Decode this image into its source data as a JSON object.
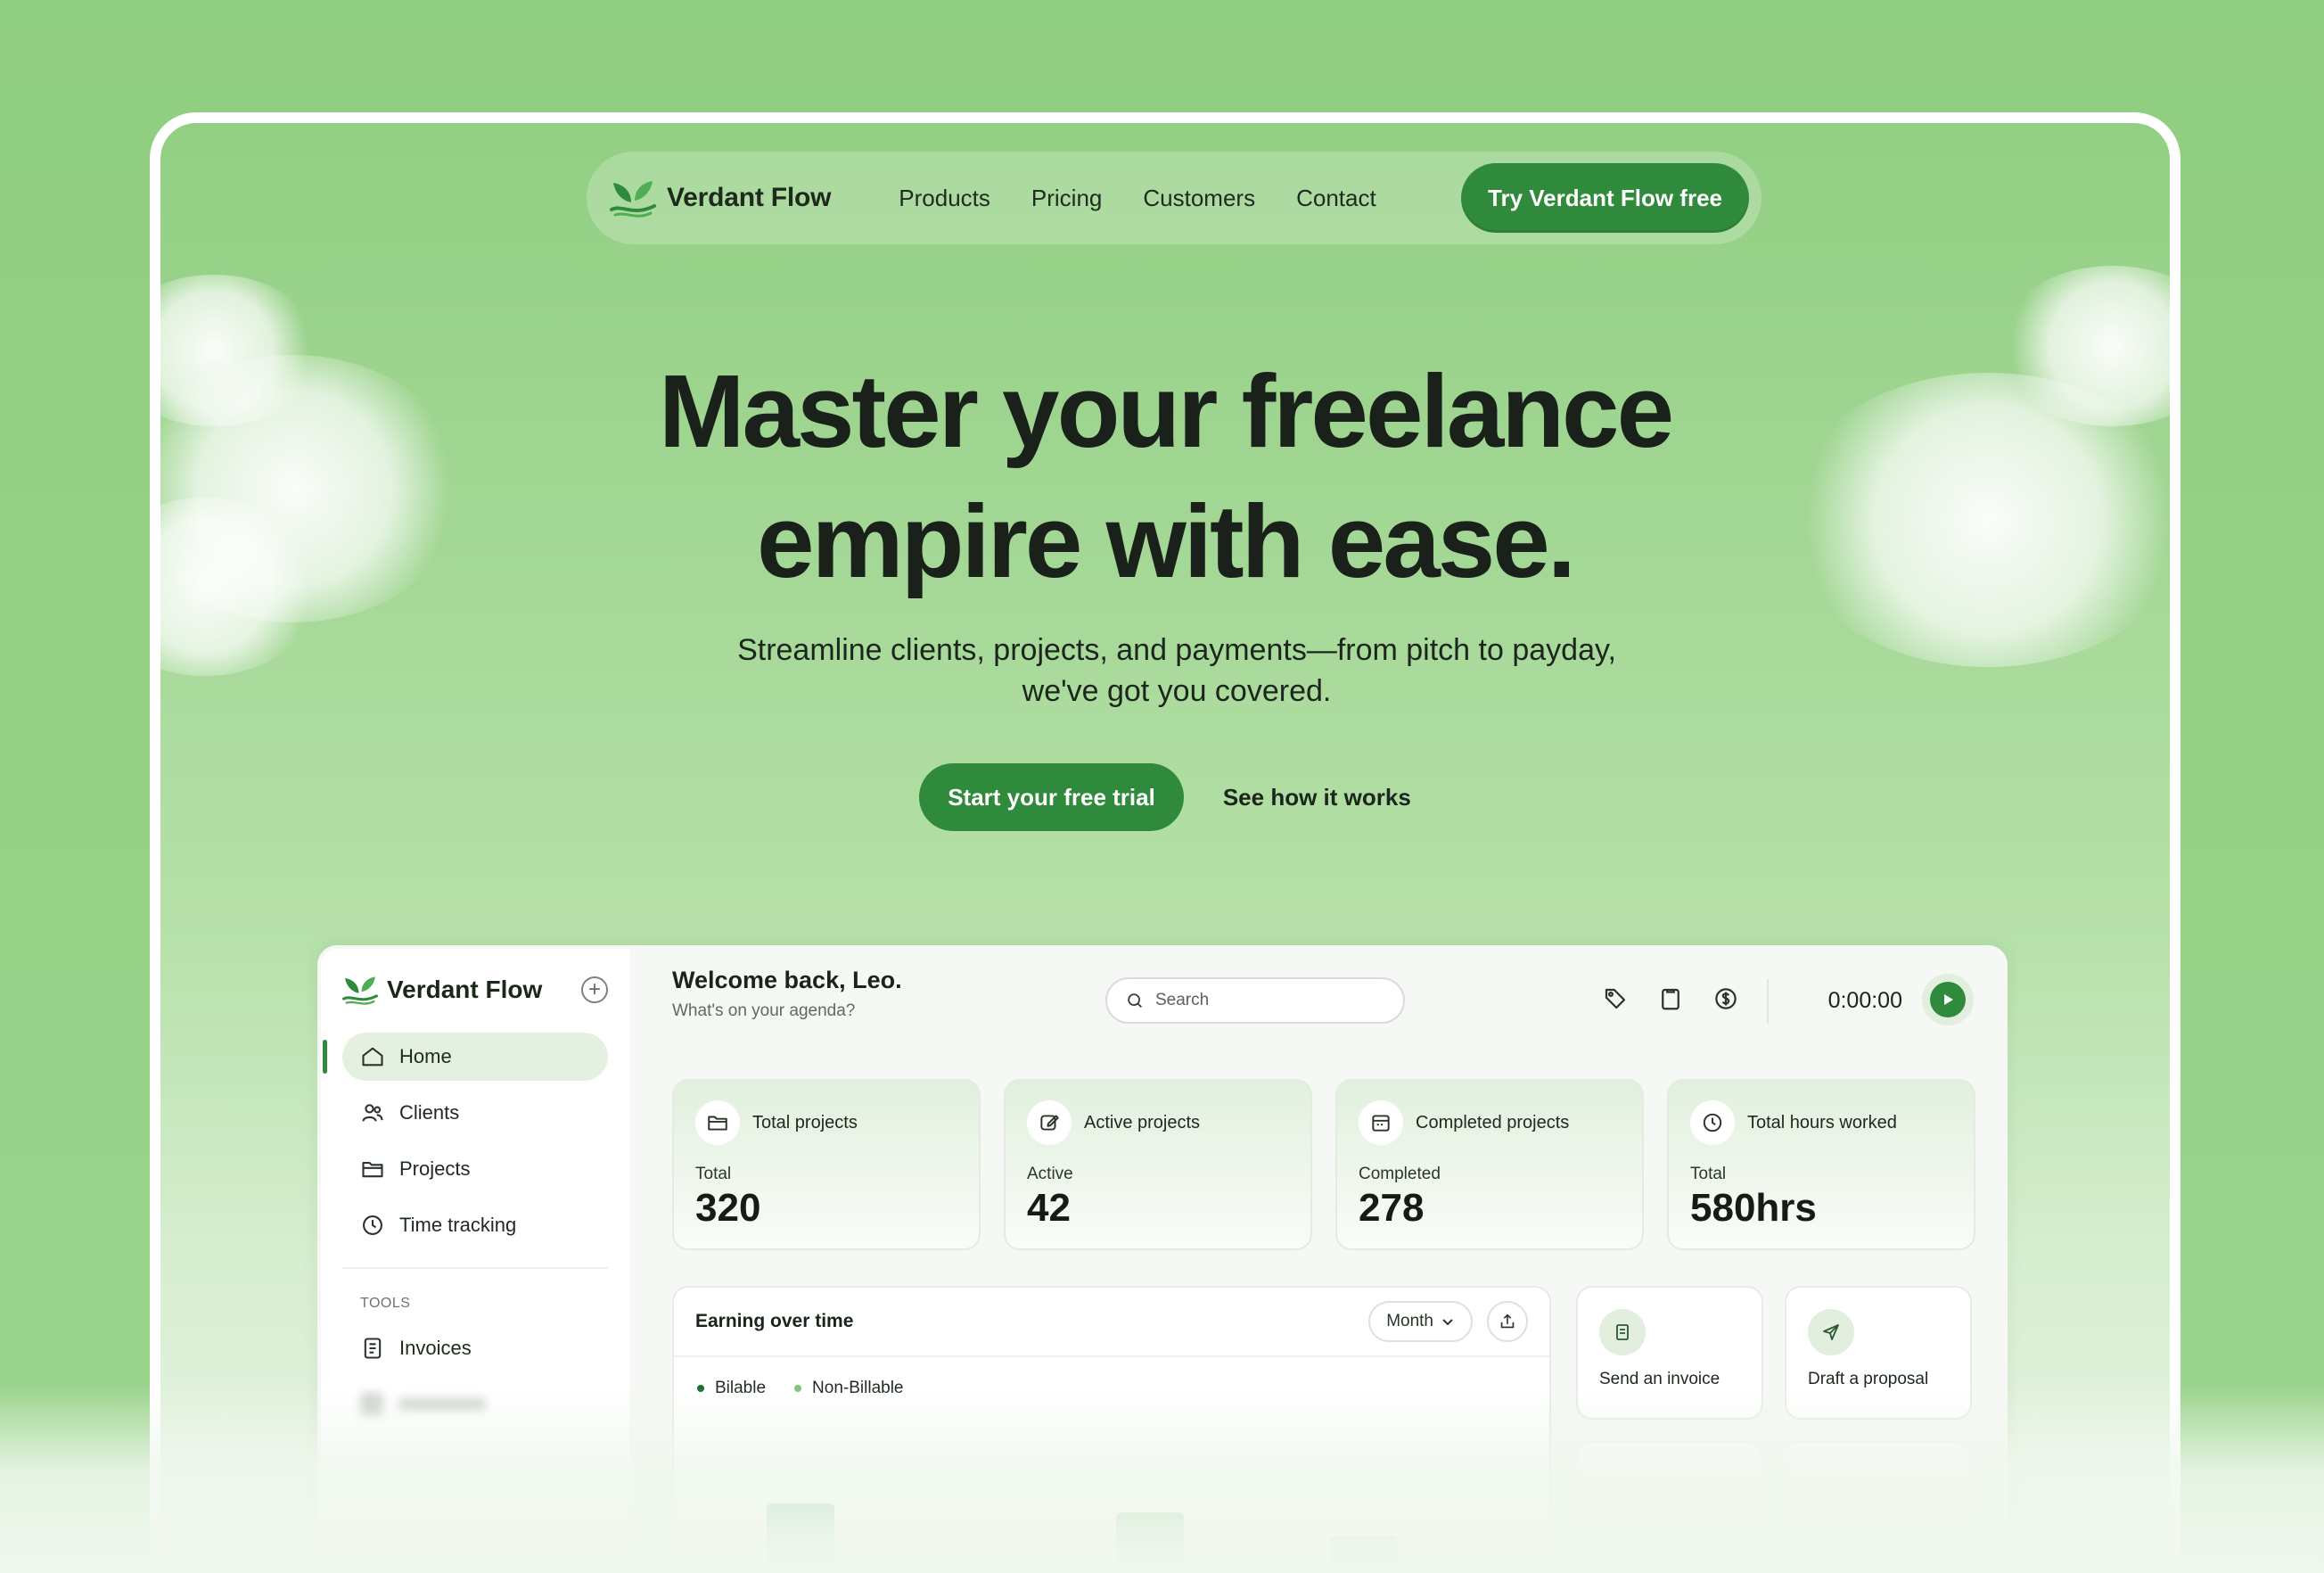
{
  "nav": {
    "brand": "Verdant Flow",
    "links": [
      "Products",
      "Pricing",
      "Customers",
      "Contact"
    ],
    "cta": "Try Verdant Flow free"
  },
  "hero": {
    "title_line1": "Master your freelance",
    "title_line2": "empire with ease.",
    "subtitle_line1": "Streamline clients, projects, and payments—from pitch to payday,",
    "subtitle_line2": "we've got you covered.",
    "primary_cta": "Start your free trial",
    "secondary_cta": "See how it works"
  },
  "dashboard": {
    "sidebar": {
      "brand": "Verdant Flow",
      "items": [
        {
          "label": "Home",
          "icon": "home-icon",
          "active": true
        },
        {
          "label": "Clients",
          "icon": "users-icon",
          "active": false
        },
        {
          "label": "Projects",
          "icon": "folder-icon",
          "active": false
        },
        {
          "label": "Time tracking",
          "icon": "clock-icon",
          "active": false
        }
      ],
      "section_label": "TOOLS",
      "tools": [
        {
          "label": "Invoices",
          "icon": "invoice-icon"
        }
      ]
    },
    "header": {
      "greeting": "Welcome back, Leo.",
      "subtext": "What's on your agenda?",
      "search_placeholder": "Search",
      "timer": "0:00:00"
    },
    "stats": [
      {
        "title": "Total projects",
        "label": "Total",
        "value": "320",
        "icon": "folder-icon"
      },
      {
        "title": "Active projects",
        "label": "Active",
        "value": "42",
        "icon": "edit-icon"
      },
      {
        "title": "Completed projects",
        "label": "Completed",
        "value": "278",
        "icon": "calendar-icon"
      },
      {
        "title": "Total hours worked",
        "label": "Total",
        "value": "580hrs",
        "icon": "clock-icon"
      }
    ],
    "chart": {
      "title": "Earning over time",
      "period": "Month",
      "legend": [
        {
          "label": "Bilable",
          "color": "#1f6b2c"
        },
        {
          "label": "Non-Billable",
          "color": "#7cc47a"
        }
      ]
    },
    "quick_actions": [
      {
        "label": "Send an invoice",
        "icon": "invoice-icon"
      },
      {
        "label": "Draft a proposal",
        "icon": "send-icon"
      }
    ]
  },
  "colors": {
    "accent": "#2f8a3b",
    "background": "#93cf85"
  }
}
